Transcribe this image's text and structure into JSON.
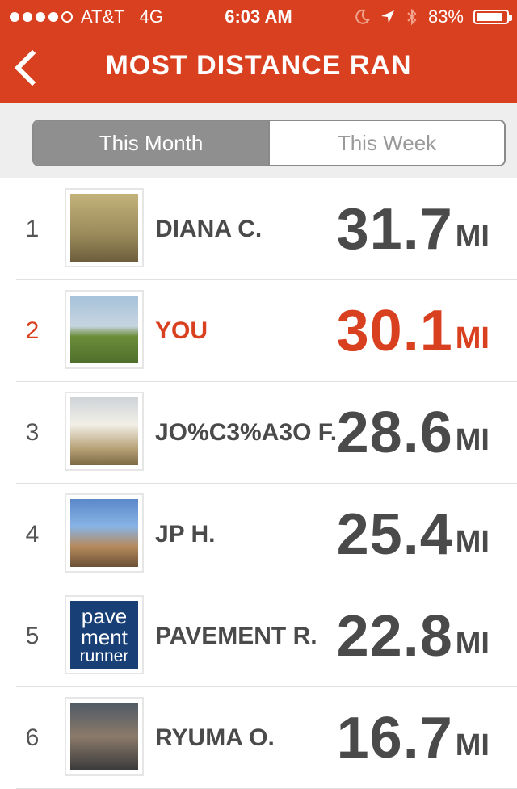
{
  "status": {
    "carrier": "AT&T",
    "network": "4G",
    "time": "6:03 AM",
    "battery": "83%"
  },
  "nav": {
    "title": "MOST DISTANCE RAN"
  },
  "tabs": [
    {
      "label": "This Month",
      "active": true
    },
    {
      "label": "This Week",
      "active": false
    }
  ],
  "leaderboard": [
    {
      "rank": "1",
      "name": "DIANA C.",
      "distance": "31.7",
      "unit": "MI"
    },
    {
      "rank": "2",
      "name": "YOU",
      "distance": "30.1",
      "unit": "MI",
      "highlight": true
    },
    {
      "rank": "3",
      "name": "JO%C3%A3O F.",
      "distance": "28.6",
      "unit": "MI"
    },
    {
      "rank": "4",
      "name": "JP H.",
      "distance": "25.4",
      "unit": "MI"
    },
    {
      "rank": "5",
      "name": "PAVEMENT R.",
      "distance": "22.8",
      "unit": "MI",
      "logo": [
        "pave",
        "ment",
        "runner"
      ]
    },
    {
      "rank": "6",
      "name": "RYUMA O.",
      "distance": "16.7",
      "unit": "MI"
    }
  ],
  "colors": {
    "accent": "#d9401f",
    "text": "#4a4a4a",
    "segment_active": "#8f8f8f"
  }
}
